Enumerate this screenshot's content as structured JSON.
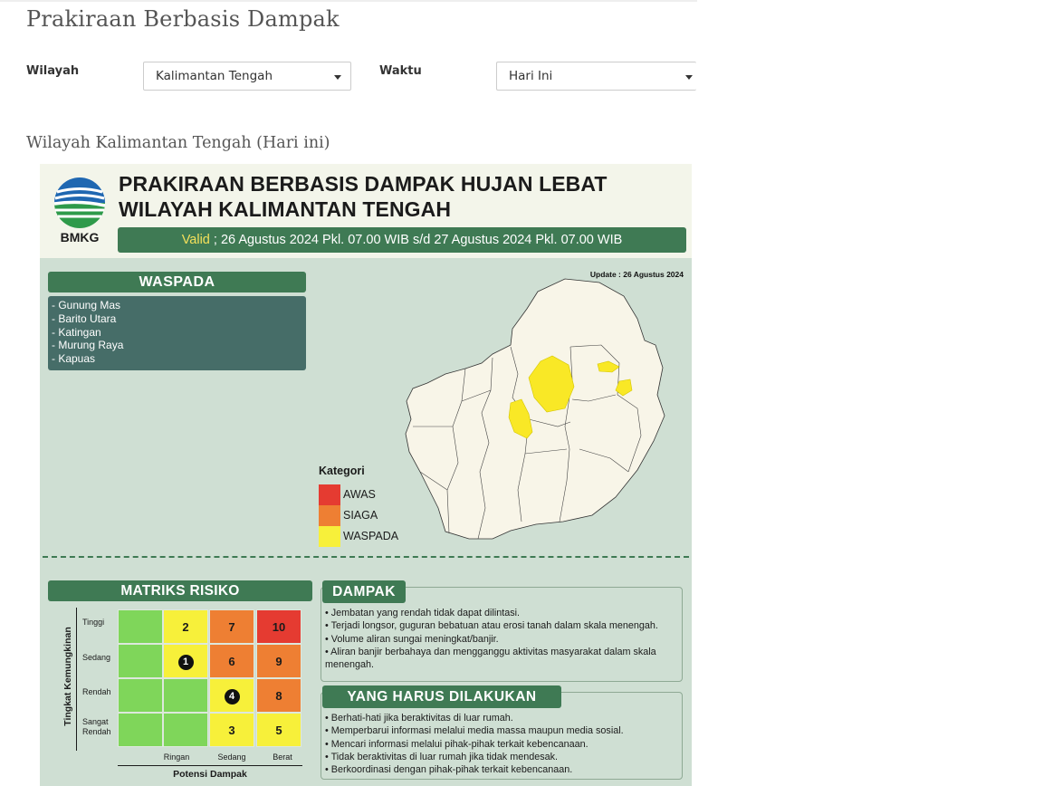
{
  "page": {
    "title": "Prakiraan Berbasis Dampak",
    "subtitle": "Wilayah Kalimantan Tengah (Hari ini)"
  },
  "filters": {
    "wilayah_label": "Wilayah",
    "wilayah_value": "Kalimantan Tengah",
    "waktu_label": "Waktu",
    "waktu_value": "Hari Ini"
  },
  "infographic": {
    "logo_text": "BMKG",
    "title_line1": "PRAKIRAAN BERBASIS DAMPAK HUJAN LEBAT",
    "title_line2": "WILAYAH KALIMANTAN TENGAH",
    "valid_word": "Valid",
    "valid_period": " ; 26 Agustus 2024 Pkl. 07.00 WIB s/d 27 Agustus 2024 Pkl. 07.00 WIB",
    "update": "Update : 26 Agustus 2024",
    "waspada": {
      "title": "WASPADA",
      "items": [
        "- Gunung Mas",
        "- Barito Utara",
        "- Katingan",
        "- Murung Raya",
        "- Kapuas"
      ]
    },
    "legend": {
      "title": "Kategori",
      "items": [
        {
          "label": "AWAS",
          "color": "#e53b31"
        },
        {
          "label": "SIAGA",
          "color": "#ee7f33"
        },
        {
          "label": "WASPADA",
          "color": "#f7f03a"
        }
      ]
    },
    "matrix": {
      "title": "MATRIKS RISIKO",
      "y_title": "Tingkat Kemungkinan",
      "x_title": "Potensi Dampak",
      "rows": [
        "Tinggi",
        "Sedang",
        "Rendah",
        "Sangat\nRendah"
      ],
      "cols": [
        "Ringan",
        "Sedang",
        "Berat"
      ],
      "cells": [
        [
          "",
          "2",
          "7",
          "10"
        ],
        [
          "",
          "1",
          "6",
          "9"
        ],
        [
          "",
          "",
          "4",
          "8"
        ],
        [
          "",
          "",
          "3",
          "5"
        ]
      ]
    },
    "dampak": {
      "title": "DAMPAK",
      "items": [
        "• Jembatan yang rendah tidak dapat dilintasi.",
        "• Terjadi longsor, guguran bebatuan atau erosi tanah dalam skala menengah.",
        "• Volume aliran sungai meningkat/banjir.",
        "• Aliran banjir berbahaya dan mengganggu aktivitas masyarakat dalam skala menengah."
      ]
    },
    "tindakan": {
      "title": "YANG HARUS DILAKUKAN",
      "items": [
        "• Berhati-hati jika beraktivitas di luar rumah.",
        "• Memperbarui informasi melalui media massa maupun media sosial.",
        "• Mencari informasi melalui pihak-pihak terkait kebencanaan.",
        "• Tidak beraktivitas di luar rumah jika tidak mendesak.",
        "• Berkoordinasi dengan pihak-pihak terkait kebencanaan."
      ]
    }
  }
}
